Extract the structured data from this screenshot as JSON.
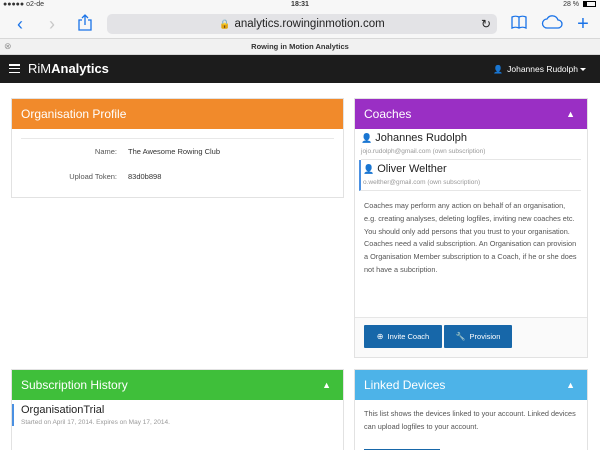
{
  "status_bar": {
    "carrier": "●●●●● o2-de",
    "time": "18:31",
    "battery": "28 %"
  },
  "browser": {
    "url": "analytics.rowinginmotion.com",
    "tab_title": "Rowing in Motion Analytics"
  },
  "navbar": {
    "brand_prefix": "RiM",
    "brand_main": "Analytics",
    "user_name": "Johannes Rudolph"
  },
  "organisation_profile": {
    "title": "Organisation Profile",
    "fields": [
      {
        "label": "Name:",
        "value": "The Awesome Rowing Club"
      },
      {
        "label": "Upload Token:",
        "value": "83d0b898"
      }
    ]
  },
  "coaches": {
    "title": "Coaches",
    "items": [
      {
        "name": "Johannes Rudolph",
        "email": "jojo.rudolph@gmail.com (own subscription)"
      },
      {
        "name": "Oliver Welther",
        "email": "o.welther@gmail.com (own subscription)"
      }
    ],
    "description": "Coaches may perform any action on behalf of an organisation, e.g. creating analyses, deleting logfiles, inviting new coaches etc. You should only add persons that you trust to your organisation. Coaches need a valid subscription. An Organisation can provision a Organisation Member subscription to a Coach, if he or she does not have a subcription.",
    "invite_label": "Invite Coach",
    "provision_label": "Provision"
  },
  "subscription_history": {
    "title": "Subscription History",
    "entries": [
      {
        "name": "OrganisationTrial",
        "dates": "Started on April 17, 2014. Expires on May 17, 2014."
      }
    ]
  },
  "linked_devices": {
    "title": "Linked Devices",
    "description": "This list shows the devices linked to your account. Linked devices can upload logfiles to your account."
  },
  "colors": {
    "organisation_header": "#f18a2b",
    "coaches_header": "#9a2fc4",
    "subscription_header": "#3fbf3a",
    "devices_header": "#4db3e8",
    "primary_button": "#1767a9",
    "navbar": "#1c1c1c"
  }
}
